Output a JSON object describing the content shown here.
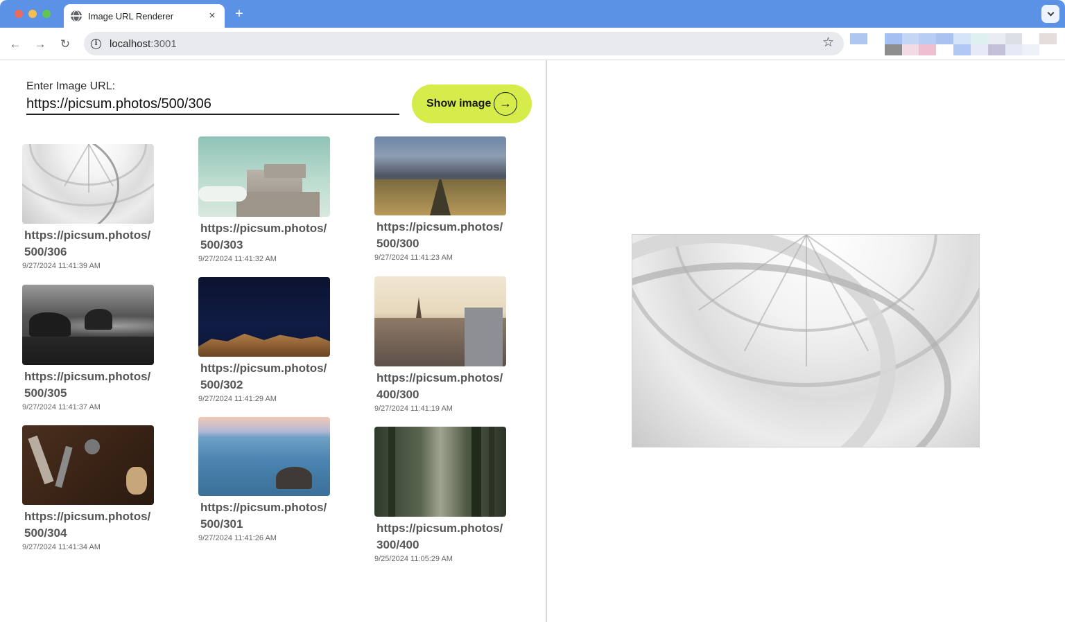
{
  "browser": {
    "tab_title": "Image URL Renderer",
    "tab_close": "×",
    "new_tab": "+",
    "url_host": "localhost",
    "url_port": ":3001",
    "back_icon": "←",
    "forward_icon": "→",
    "reload_icon": "↻",
    "star_icon": "☆",
    "info_icon": "i",
    "extension_colors": [
      "#aec6f0",
      "#ffffff",
      "#a4c0f2",
      "#c5d6f5",
      "#b8cdf4",
      "#a9c2ef",
      "#d6e4f7",
      "#dff1ee",
      "#e9ecf3",
      "#dcdfe6",
      "#ffffff",
      "#e5dcdc",
      "#ffffff",
      "#ffffff",
      "#8d8d8d",
      "#f3dbe6",
      "#eebfd0",
      "#ffffff",
      "#b1c8f4",
      "#e6eaf8",
      "#c4bfd8",
      "#e4e9f5",
      "#eef0f7",
      "#ffffff"
    ]
  },
  "form": {
    "label": "Enter Image URL:",
    "url_value": "https://picsum.photos/500/306",
    "button_label": "Show image",
    "button_icon": "→",
    "accent_color": "#d6ec4b"
  },
  "gallery": [
    {
      "url": "https://picsum.photos/500/306",
      "time": "9/27/2024 11:41:39 AM",
      "photo": "rotunda-interior"
    },
    {
      "url": "https://picsum.photos/500/303",
      "time": "9/27/2024 11:41:32 AM",
      "photo": "concrete-bunker-sky"
    },
    {
      "url": "https://picsum.photos/500/300",
      "time": "9/27/2024 11:41:23 AM",
      "photo": "field-path-clouds"
    },
    {
      "url": "https://picsum.photos/500/305",
      "time": "9/27/2024 11:41:37 AM",
      "photo": "rocky-sea-bw"
    },
    {
      "url": "https://picsum.photos/500/302",
      "time": "9/27/2024 11:41:29 AM",
      "photo": "night-sky-mountains"
    },
    {
      "url": "https://picsum.photos/400/300",
      "time": "9/27/2024 11:41:19 AM",
      "photo": "city-rooftops-church"
    },
    {
      "url": "https://picsum.photos/500/304",
      "time": "9/27/2024 11:41:34 AM",
      "photo": "tools-on-wood"
    },
    {
      "url": "https://picsum.photos/500/301",
      "time": "9/27/2024 11:41:26 AM",
      "photo": "sea-rock-sunset"
    },
    {
      "url": "https://picsum.photos/300/400",
      "time": "9/25/2024 11:05:29 AM",
      "photo": "misty-forest"
    }
  ],
  "preview": {
    "photo": "rotunda-interior"
  }
}
